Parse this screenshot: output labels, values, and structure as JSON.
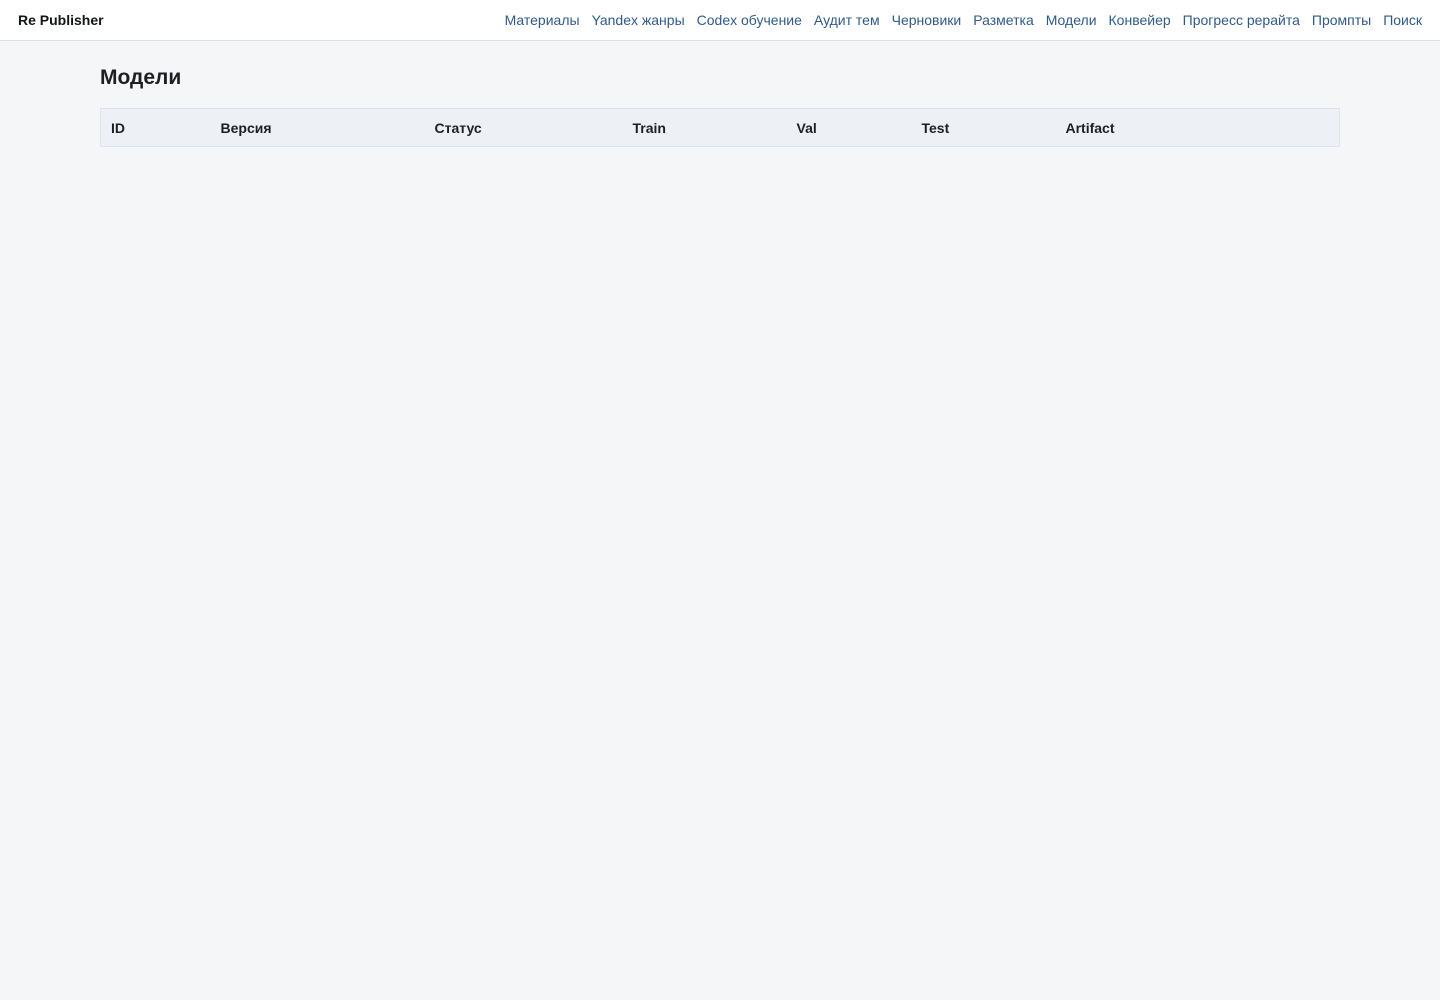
{
  "header": {
    "brand": "Re Publisher",
    "nav": [
      {
        "label": "Материалы"
      },
      {
        "label": "Yandex жанры"
      },
      {
        "label": "Codex обучение"
      },
      {
        "label": "Аудит тем"
      },
      {
        "label": "Черновики"
      },
      {
        "label": "Разметка"
      },
      {
        "label": "Модели"
      },
      {
        "label": "Конвейер"
      },
      {
        "label": "Прогресс рерайта"
      },
      {
        "label": "Промпты"
      },
      {
        "label": "Поиск"
      }
    ]
  },
  "main": {
    "title": "Модели",
    "table": {
      "columns": [
        "ID",
        "Версия",
        "Статус",
        "Train",
        "Val",
        "Test",
        "Artifact"
      ],
      "rows": []
    }
  },
  "colors": {
    "background": "#f4f6f8",
    "header_bg": "#ffffff",
    "link": "#2f5a8a",
    "table_header_bg": "#edf1f6"
  }
}
